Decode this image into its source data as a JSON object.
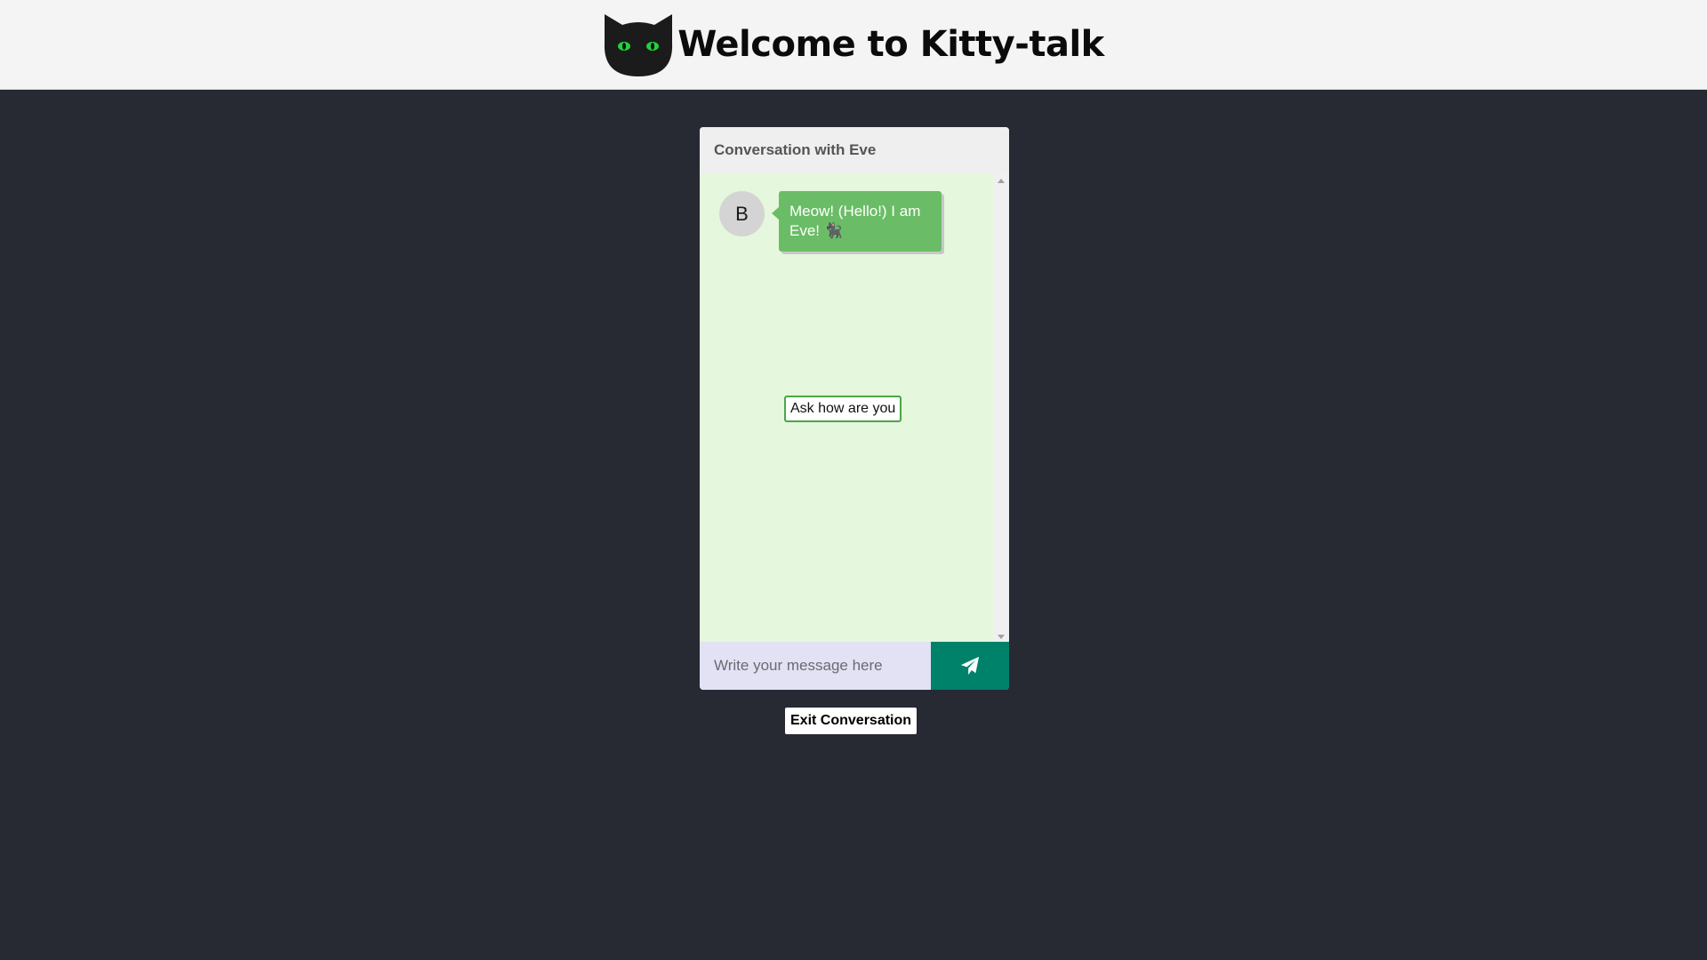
{
  "header": {
    "title": "Welcome to Kitty-talk",
    "logo_icon": "black-cat-face-icon"
  },
  "chat": {
    "title": "Conversation with Eve",
    "messages": [
      {
        "sender_initial": "B",
        "text": "Meow! (Hello!) I am Eve! 🐈‍⬛"
      }
    ],
    "options": [
      "Ask how are you"
    ],
    "input_placeholder": "Write your message here",
    "send_icon": "paper-plane-icon"
  },
  "actions": {
    "exit_label": "Exit Conversation"
  },
  "colors": {
    "page_background": "#272a33",
    "header_background": "#f4f4f4",
    "chat_body_background": "#e5f7dc",
    "bubble_background": "#6abd66",
    "option_border": "#4aa648",
    "input_background": "#e3e2f4",
    "send_button": "#00816a",
    "cat_eye": "#22d13a"
  }
}
